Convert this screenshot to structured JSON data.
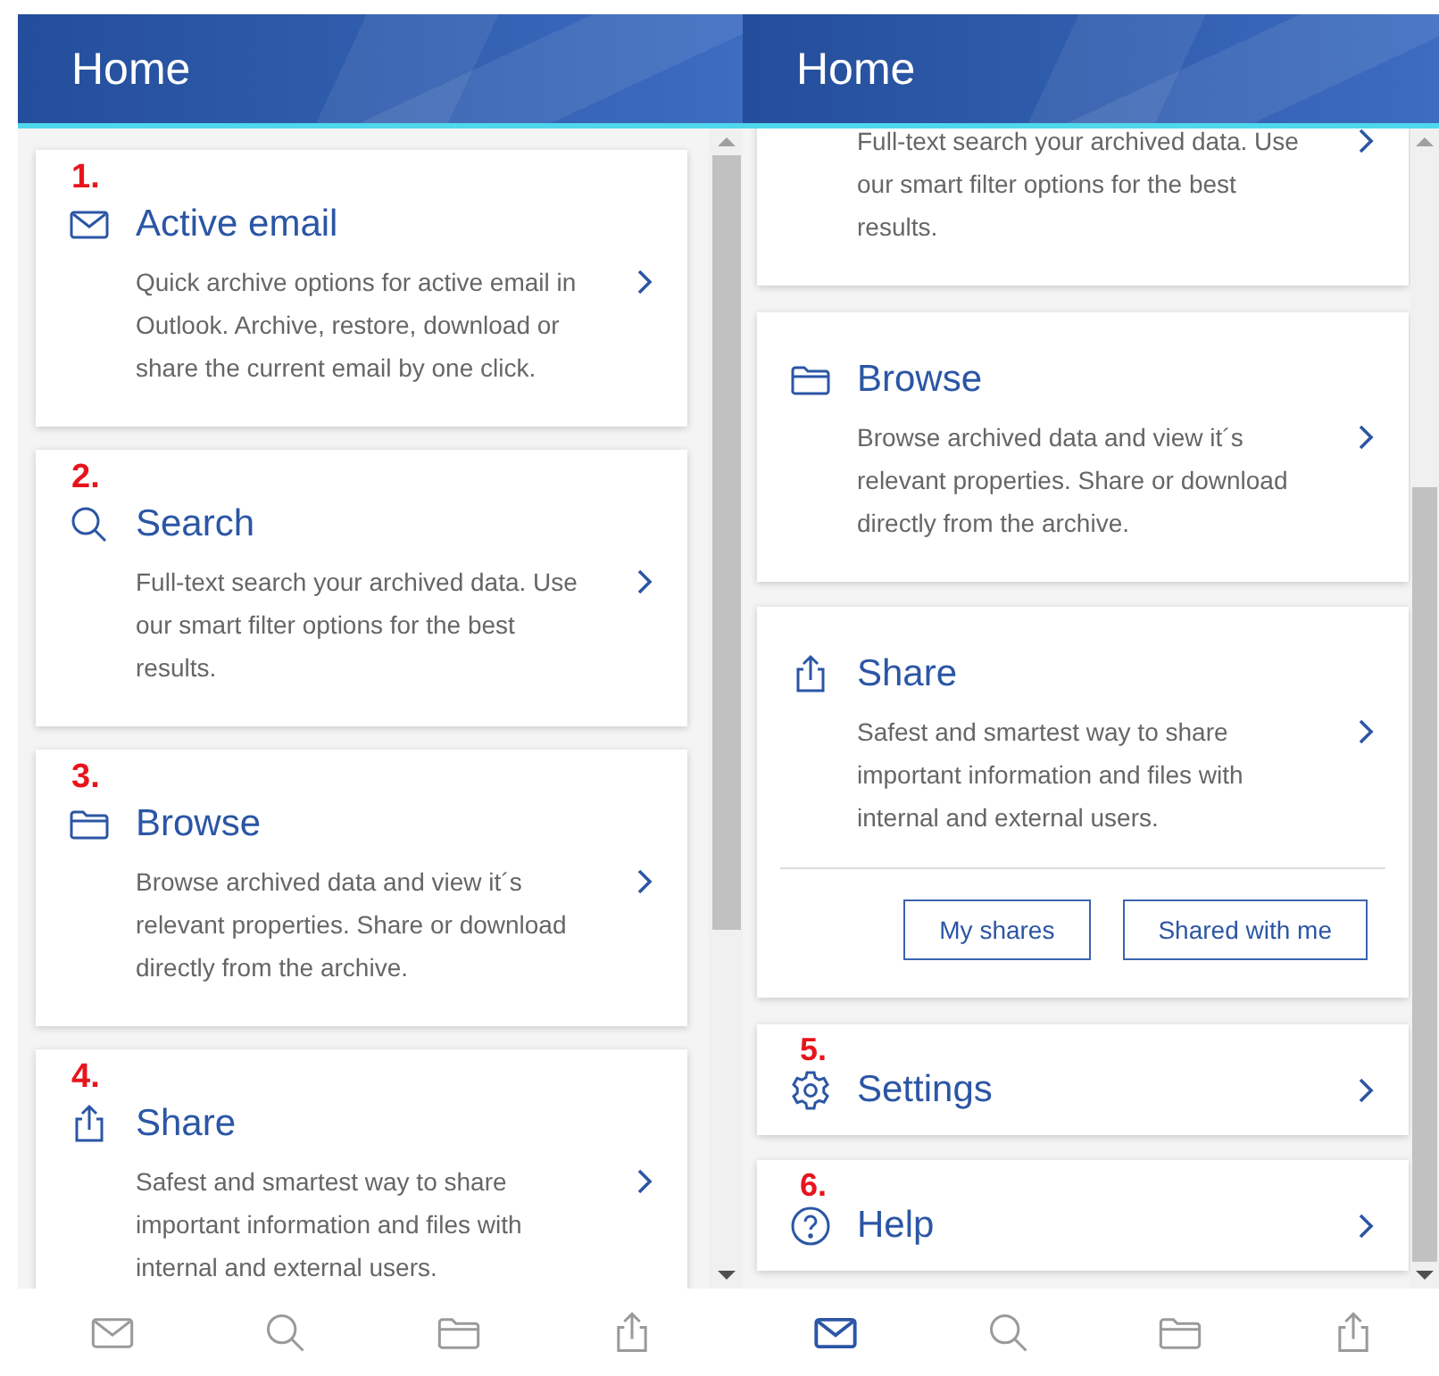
{
  "panels": [
    {
      "title": "Home",
      "cards": [
        {
          "kind": "mail",
          "annotation": "1.",
          "title": "Active email",
          "description": "Quick archive options for active email in Outlook. Archive, restore, download or share the current email by one click."
        },
        {
          "kind": "search",
          "annotation": "2.",
          "title": "Search",
          "description": "Full-text search your archived data. Use our smart filter options for the best results."
        },
        {
          "kind": "folder",
          "annotation": "3.",
          "title": "Browse",
          "description": "Browse archived data and view it´s relevant properties. Share or download directly from the archive."
        },
        {
          "kind": "share",
          "annotation": "4.",
          "title": "Share",
          "description": "Safest and smartest way to share important information and files with internal and external users."
        }
      ],
      "nav": [
        {
          "kind": "mail",
          "selected": false
        },
        {
          "kind": "search",
          "selected": false
        },
        {
          "kind": "folder",
          "selected": false
        },
        {
          "kind": "share",
          "selected": false
        }
      ]
    },
    {
      "title": "Home",
      "cards": [
        {
          "kind": "search",
          "description": "Full-text search your archived data. Use our smart filter options for the best results."
        },
        {
          "kind": "folder",
          "title": "Browse",
          "description": "Browse archived data and view it´s relevant properties. Share or download directly from the archive."
        },
        {
          "kind": "share",
          "title": "Share",
          "description": "Safest and smartest way to share important information and files with internal and external users.",
          "buttons": [
            "My shares",
            "Shared with me"
          ]
        },
        {
          "kind": "gear",
          "annotation": "5.",
          "title": "Settings"
        },
        {
          "kind": "help",
          "annotation": "6.",
          "title": "Help"
        }
      ],
      "nav": [
        {
          "kind": "mail",
          "selected": true
        },
        {
          "kind": "search",
          "selected": false
        },
        {
          "kind": "folder",
          "selected": false
        },
        {
          "kind": "share",
          "selected": false
        }
      ]
    }
  ]
}
